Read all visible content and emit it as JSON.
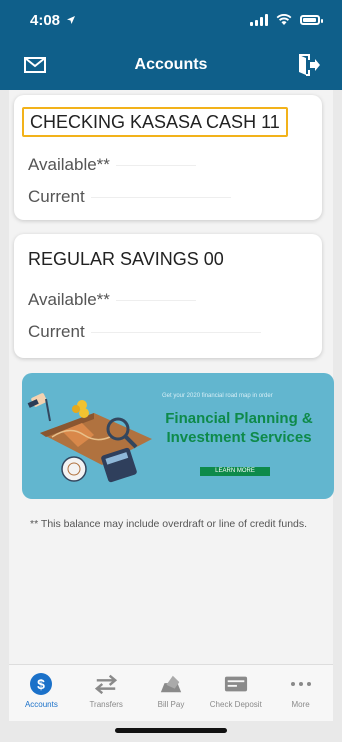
{
  "status": {
    "time": "4:08"
  },
  "nav": {
    "title": "Accounts"
  },
  "accounts": [
    {
      "name": "CHECKING KASASA CASH 11",
      "available_label": "Available**",
      "current_label": "Current"
    },
    {
      "name": "REGULAR SAVINGS 00",
      "available_label": "Available**",
      "current_label": "Current"
    }
  ],
  "promo": {
    "tagline": "Get your 2020 financial road map in order",
    "title_line1": "Financial Planning &",
    "title_line2": "Investment Services",
    "button": "LEARN MORE"
  },
  "disclaimer": "** This balance may include overdraft or line of credit funds.",
  "tabs": [
    {
      "label": "Accounts",
      "icon": "dollar-icon"
    },
    {
      "label": "Transfers",
      "icon": "transfer-arrows-icon"
    },
    {
      "label": "Bill Pay",
      "icon": "bill-pay-icon"
    },
    {
      "label": "Check Deposit",
      "icon": "check-deposit-icon"
    },
    {
      "label": "More",
      "icon": "more-dots-icon"
    }
  ],
  "colors": {
    "header": "#0f5f8a",
    "accent": "#1b71c9",
    "promo_bg": "#62b6cf",
    "promo_green": "#0e8a4a",
    "highlight": "#f2b21a"
  }
}
